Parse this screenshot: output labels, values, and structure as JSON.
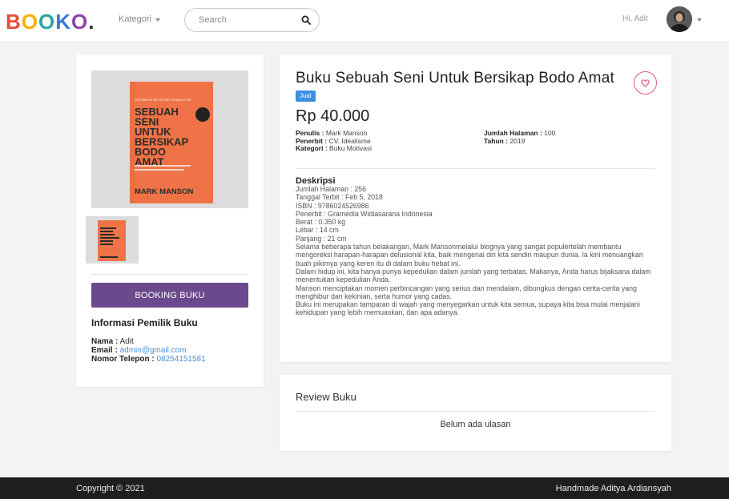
{
  "header": {
    "logo_text": "BOOKO.",
    "kategori_label": "Kategori",
    "search_placeholder": "Search",
    "greeting": "Hi, Adit"
  },
  "book": {
    "title": "Buku Sebuah Seni Untuk Bersikap Bodo Amat",
    "badge": "Jual",
    "price": "Rp 40.000",
    "meta": {
      "penulis_label": "Penulis :",
      "penulis": "Mark Manson",
      "penerbit_label": "Penerbit :",
      "penerbit": "CV. Idealisme",
      "kategori_label": "Kategori :",
      "kategori": "Buku Motivasi",
      "halaman_label": "Jumlah Halaman :",
      "halaman": "100",
      "tahun_label": "Tahun :",
      "tahun": "2019"
    },
    "cover": {
      "small_caption": "THE SUBTLE ART OF NOT GIVING A F*CK",
      "title_lines": [
        "SEBUAH",
        "SENI",
        "UNTUK",
        "BERSIKAP",
        "BODO",
        "AMAT"
      ],
      "author": "MARK MANSON",
      "color": "#f0734a"
    }
  },
  "description": {
    "title": "Deskripsi",
    "lines": [
      "Jumlah Halaman : 256",
      "Tanggal Terbit : Feb 5, 2018",
      "ISBN : 9786024526986",
      "Penerbit : Gramedia Widiasarana Indonesia",
      "Berat : 0.350 kg",
      "Lebar : 14 cm",
      "Panjang : 21 cm",
      "Selama beberapa tahun belakangan, Mark Mansonmelalui blognya yang sangat populertelah membantu mengoreksi harapan-harapan delusional kita, baik mengenai diri kita sendiri maupun dunia. Ia kini menuangkan buah pikirnya yang keren itu di dalam buku hebat ini.",
      "Dalam hidup ini, kita hanya punya kepedulian dalam jumlah yang terbatas. Makanya, Anda harus bijaksana dalam menentukan kepedulian Anda.",
      "Manson menciptakan momen perbincangan yang serius dan mendalam, dibungkus dengan cerita-cerita yang menghibur dan kekinian, serta humor yang cadas.",
      "Buku ini merupakan tamparan di wajah yang menyegarkan untuk kita semua, supaya kita bisa mulai menjalani kehidupan yang lebih memuaskan, dan apa adanya."
    ]
  },
  "sidebar": {
    "booking_button": "BOOKING BUKU",
    "owner_title": "Informasi Pemilik Buku",
    "nama_label": "Nama :",
    "nama": "Adit",
    "email_label": "Email :",
    "email": "admin@gmail.com",
    "telepon_label": "Nomor Telepon :",
    "telepon": "08254151581"
  },
  "review": {
    "title": "Review Buku",
    "empty_text": "Belum ada ulasan"
  },
  "footer": {
    "copyright": "Copyright © 2021",
    "credit": "Handmade Aditya Ardiansyah"
  },
  "colors": {
    "accent_purple": "#6a4a8c",
    "badge_blue": "#3b8fe0",
    "heart_pink": "#e05a7a",
    "link_blue": "#4a8fd8",
    "footer_bg": "#1e1e1f"
  }
}
